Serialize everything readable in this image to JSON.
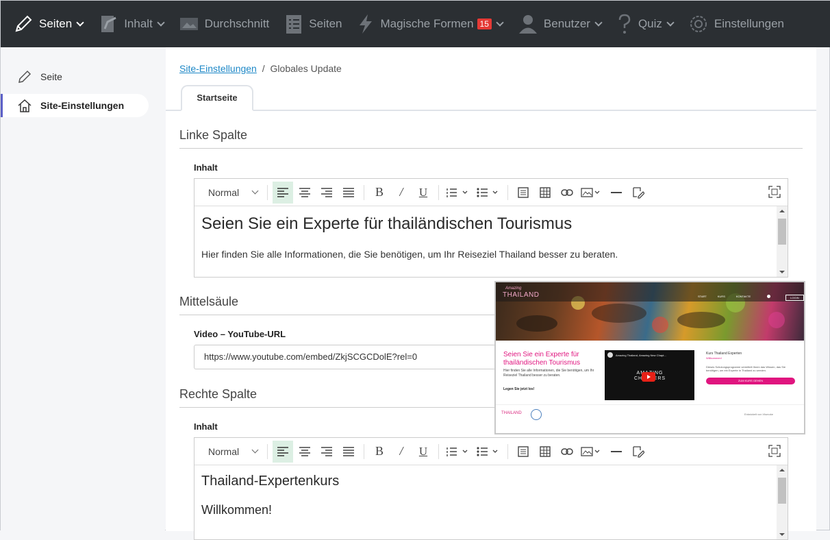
{
  "topbar": {
    "items": [
      {
        "label": "Seiten",
        "icon": "pencil-icon"
      },
      {
        "label": "Inhalt",
        "icon": "content-icon"
      },
      {
        "label": "Durchschnitt",
        "icon": "image-icon"
      },
      {
        "label": "Seiten",
        "icon": "checklist-icon"
      },
      {
        "label": "Magische Formen",
        "icon": "lightning-icon",
        "badge": "15"
      },
      {
        "label": "Benutzer",
        "icon": "user-icon"
      },
      {
        "label": "Quiz",
        "icon": "question-icon"
      },
      {
        "label": "Einstellungen",
        "icon": "gear-icon"
      }
    ]
  },
  "sidebar": {
    "items": [
      {
        "label": "Seite",
        "icon": "pencil-icon"
      },
      {
        "label": "Site-Einstellungen",
        "icon": "home-icon"
      }
    ]
  },
  "breadcrumb": {
    "link": "Site-Einstellungen",
    "separator": "/",
    "current": "Globales Update"
  },
  "tabs": [
    {
      "label": "Startseite"
    }
  ],
  "sections": {
    "left": {
      "title": "Linke Spalte",
      "field_label": "Inhalt",
      "heading": "Seien Sie ein Experte für thailändischen Tourismus",
      "paragraph": "Hier finden Sie alle Informationen, die Sie benötigen, um Ihr Reiseziel Thailand besser zu beraten."
    },
    "middle": {
      "title": "Mittelsäule",
      "field_label": "Video – YouTube-URL",
      "url_value": "https://www.youtube.com/embed/ZkjSCGCDolE?rel=0"
    },
    "right": {
      "title": "Rechte Spalte",
      "field_label": "Inhalt",
      "heading": "Thailand-Expertenkurs",
      "paragraph": "Willkommen!"
    }
  },
  "editor_toolbar": {
    "format_select": "Normal"
  },
  "preview": {
    "brand_top": "Amazing",
    "brand": "THAILAND",
    "nav": [
      "START",
      "KURS",
      "KONTAKTE",
      "LOGIN"
    ],
    "heading": "Seien Sie ein Experte für thailändischen Tourismus",
    "text": "Hier finden Sie alle Informationen, die Sie benötigen, um Ihr Reiseziel Thailand besser zu beraten.",
    "cta_text": "Legen Sie jetzt los!",
    "video_title": "Amazing Thailand, Amazing New Chapt...",
    "video_overlay": "AMAZING CHAPTERS",
    "course_title": "Kurs Thailand Experten",
    "course_welcome": "Willkommen!",
    "course_desc": "Dieses Schulungsprogramm vermittelt Ihnen das Wissen, das Sie benötigen, um ein Experte in Thailand zu werden.",
    "course_button": "ZUM KURS GEHEN",
    "footer_credit": "Entwickelt von Vismoke"
  },
  "colors": {
    "accent": "#e0157f",
    "topbar": "#2b2f33",
    "link": "#1e88c7",
    "active_tool": "#dcefe3"
  }
}
